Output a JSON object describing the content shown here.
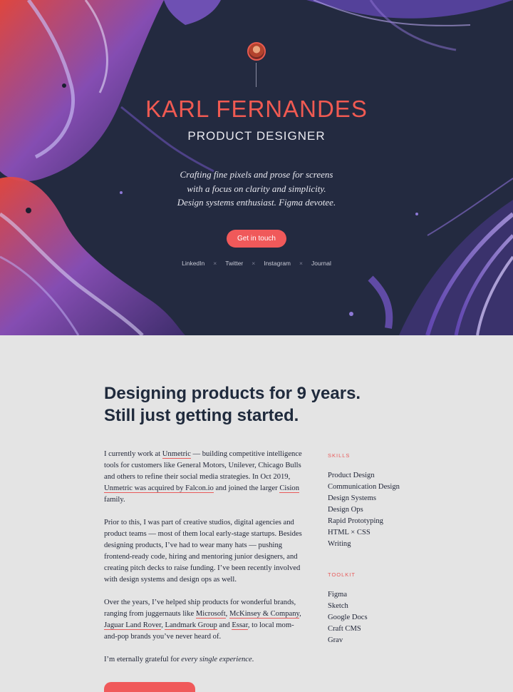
{
  "hero": {
    "name": "KARL FERNANDES",
    "role": "PRODUCT DESIGNER",
    "tagline": [
      "Crafting fine pixels and prose for screens",
      "with a focus on clarity and simplicity.",
      "Design systems enthusiast. Figma devotee."
    ],
    "cta_label": "Get in touch",
    "social": [
      "LinkedIn",
      "Twitter",
      "Instagram",
      "Journal"
    ],
    "separator": "×"
  },
  "main": {
    "headline": [
      "Designing products for 9 years.",
      "Still just getting started."
    ],
    "bio": {
      "p1": {
        "t1": "I currently work at ",
        "link1": "Unmetric",
        "t2": " — building competitive intelligence tools for customers like General Motors, Unilever, Chicago Bulls and others to refine their social media strategies. In Oct 2019, ",
        "link2": "Unmetric was acquired by Falcon.io",
        "t3": " and joined the larger ",
        "link3": "Cision",
        "t4": " family."
      },
      "p2": "Prior to this, I was part of creative studios, digital agencies and product teams — most of them local early-stage startups. Besides designing products, I’ve had to wear many hats — pushing frontend-ready code, hiring and mentoring junior designers, and creating pitch decks to raise funding. I’ve been recently involved with design systems and design ops as well.",
      "p3": {
        "t1": "Over the years, I’ve helped ship products for wonderful brands, ranging from juggernauts like ",
        "link1": "Microsoft",
        "t2": ", ",
        "link2": "McKinsey & Company",
        "t3": ", ",
        "link3": "Jaguar Land Rover",
        "t4": ", ",
        "link4": "Landmark Group",
        "t5": " and ",
        "link5": "Essar",
        "t6": ", to local mom-and-pop brands you’ve never heard of."
      },
      "p4": {
        "t1": "I’m eternally grateful for ",
        "em": "every single experience",
        "t2": "."
      }
    },
    "skills": {
      "title": "SKILLS",
      "items": [
        "Product Design",
        "Communication Design",
        "Design Systems",
        "Design Ops",
        "Rapid Prototyping",
        "HTML × CSS",
        "Writing"
      ]
    },
    "toolkit": {
      "title": "TOOLKIT",
      "items": [
        "Figma",
        "Sketch",
        "Google Docs",
        "Craft CMS",
        "Grav"
      ]
    }
  },
  "colors": {
    "accent": "#f0595a",
    "hero_bg": "#232a40",
    "page_bg": "#e4e4e4",
    "text_dark": "#1f2436"
  }
}
